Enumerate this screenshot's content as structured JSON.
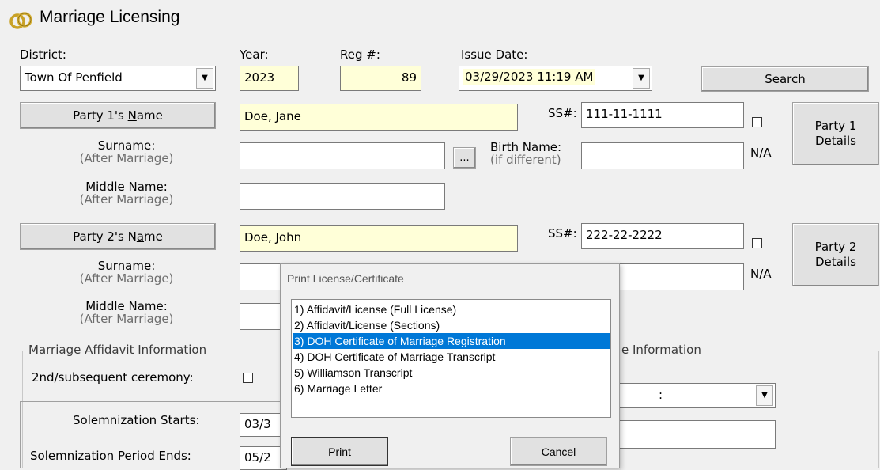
{
  "window": {
    "title": "Marriage Licensing",
    "icon": "wedding-rings-icon"
  },
  "header": {
    "district_label": "District:",
    "district_value": "Town Of Penfield",
    "year_label": "Year:",
    "year_value": "2023",
    "reg_label": "Reg #:",
    "reg_value": "89",
    "issue_label": "Issue Date:",
    "issue_value": "03/29/2023 11:19 AM",
    "search_label": "Search"
  },
  "party1": {
    "name_btn_pre": "Party 1's ",
    "name_btn_u": "N",
    "name_btn_post": "ame",
    "name_value": "Doe, Jane",
    "ss_label": "SS#:",
    "ss_value": "111-11-1111",
    "details_pre": "Party ",
    "details_u": "1",
    "details_l2": "Details",
    "surname_label": "Surname:",
    "surname_sub": "(After Marriage)",
    "ellipsis": "...",
    "birth_label": "Birth Name:",
    "birth_sub": "(if different)",
    "na_label": "N/A",
    "middle_label": "Middle Name:",
    "middle_sub": "(After Marriage)"
  },
  "party2": {
    "name_btn_pre": "Party 2's N",
    "name_btn_u": "a",
    "name_btn_post": "me",
    "name_value": "Doe, John",
    "ss_label": "SS#:",
    "ss_value": "222-22-2222",
    "details_pre": "Party ",
    "details_u": "2",
    "details_l2": "Details",
    "surname_label": "Surname:",
    "surname_sub": "(After Marriage)",
    "na_label": "N/A",
    "middle_label": "Middle Name:",
    "middle_sub": "(After Marriage)"
  },
  "affidavit": {
    "group_title": "Marriage Affidavit Information",
    "ceremony_label": "2nd/subsequent ceremony:",
    "right_group_title": "e Information",
    "time_colon": ":"
  },
  "solemnization": {
    "starts_label": "Solemnization Starts:",
    "starts_value": "03/3",
    "ends_label": "Solemnization Period Ends:",
    "ends_value": "05/2"
  },
  "dialog": {
    "title": "Print License/Certificate",
    "items": [
      "1) Affidavit/License (Full License)",
      "2) Affidavit/License (Sections)",
      "3) DOH Certificate of Marriage Registration",
      "4) DOH Certificate of Marriage Transcript",
      "5) Williamson Transcript",
      "6) Marriage Letter"
    ],
    "selected_index": 2,
    "print_u": "P",
    "print_rest": "rint",
    "cancel_u": "C",
    "cancel_rest": "ancel"
  },
  "colors": {
    "highlight": "#0078d7",
    "required_field": "#ffffd8"
  }
}
